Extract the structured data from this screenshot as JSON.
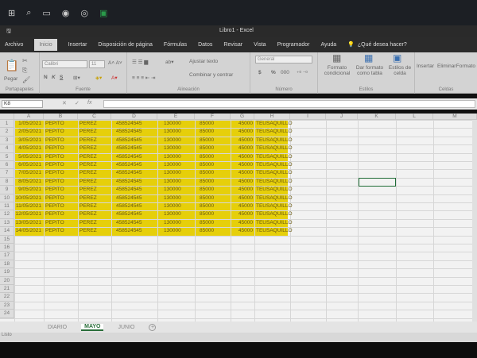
{
  "window": {
    "title": "Libro1 - Excel"
  },
  "tabs": [
    "Archivo",
    "Inicio",
    "Insertar",
    "Disposición de página",
    "Fórmulas",
    "Datos",
    "Revisar",
    "Vista",
    "Programador",
    "Ayuda"
  ],
  "tell_me": "¿Qué desea hacer?",
  "ribbon": {
    "clipboard": {
      "paste": "Pegar",
      "label": "Portapapeles"
    },
    "font": {
      "name": "Calibri",
      "size": "11",
      "bold": "N",
      "italic": "K",
      "underline": "S",
      "label": "Fuente"
    },
    "alignment": {
      "wrap": "Ajustar texto",
      "merge": "Combinar y centrar",
      "label": "Alineación"
    },
    "number": {
      "format": "General",
      "currency": "$",
      "percent": "%",
      "thousands": "000",
      "label": "Número"
    },
    "styles": {
      "conditional": "Formato condicional",
      "table": "Dar formato como tabla",
      "cell": "Estilos de celda",
      "label": "Estilos"
    },
    "cells": {
      "insert": "Insertar",
      "delete": "Eliminar",
      "format": "Formato",
      "label": "Celdas"
    }
  },
  "formula_bar": {
    "name_box": "K8",
    "cancel": "✕",
    "enter": "✓",
    "fx": "fx",
    "value": ""
  },
  "columns": [
    "A",
    "B",
    "C",
    "D",
    "E",
    "F",
    "G",
    "H",
    "I",
    "J",
    "K",
    "L",
    "M"
  ],
  "rows": [
    [
      "1/05/2021",
      "PEPITO",
      "PEREZ",
      "458524545",
      "130000",
      "85000",
      "45000",
      "TEUSAQUILLO"
    ],
    [
      "2/05/2021",
      "PEPITO",
      "PEREZ",
      "458524545",
      "130000",
      "85000",
      "45000",
      "TEUSAQUILLO"
    ],
    [
      "3/05/2021",
      "PEPITO",
      "PEREZ",
      "458524545",
      "130000",
      "85000",
      "45000",
      "TEUSAQUILLO"
    ],
    [
      "4/05/2021",
      "PEPITO",
      "PEREZ",
      "458524545",
      "130000",
      "85000",
      "45000",
      "TEUSAQUILLO"
    ],
    [
      "5/05/2021",
      "PEPITO",
      "PEREZ",
      "458524545",
      "130000",
      "85000",
      "45000",
      "TEUSAQUILLO"
    ],
    [
      "6/05/2021",
      "PEPITO",
      "PEREZ",
      "458524545",
      "130000",
      "85000",
      "45000",
      "TEUSAQUILLO"
    ],
    [
      "7/05/2021",
      "PEPITO",
      "PEREZ",
      "458524545",
      "130000",
      "85000",
      "45000",
      "TEUSAQUILLO"
    ],
    [
      "8/05/2021",
      "PEPITO",
      "PEREZ",
      "458524545",
      "130000",
      "85000",
      "45000",
      "TEUSAQUILLO"
    ],
    [
      "9/05/2021",
      "PEPITO",
      "PEREZ",
      "458524545",
      "130000",
      "85000",
      "45000",
      "TEUSAQUILLO"
    ],
    [
      "10/05/2021",
      "PEPITO",
      "PEREZ",
      "458524545",
      "130000",
      "85000",
      "45000",
      "TEUSAQUILLO"
    ],
    [
      "11/05/2021",
      "PEPITO",
      "PEREZ",
      "458524545",
      "130000",
      "85000",
      "45000",
      "TEUSAQUILLO"
    ],
    [
      "12/05/2021",
      "PEPITO",
      "PEREZ",
      "458524545",
      "130000",
      "85000",
      "45000",
      "TEUSAQUILLO"
    ],
    [
      "13/05/2021",
      "PEPITO",
      "PEREZ",
      "458524545",
      "130000",
      "85000",
      "45000",
      "TEUSAQUILLO"
    ],
    [
      "14/05/2021",
      "PEPITO",
      "PEREZ",
      "458524545",
      "130000",
      "85000",
      "45000",
      "TEUSAQUILLO"
    ]
  ],
  "total_rows": 24,
  "selected_cell": "K8",
  "highlight_color": "#e6cf0a",
  "sheets": [
    {
      "name": "DIARIO",
      "active": false
    },
    {
      "name": "MAYO",
      "active": true
    },
    {
      "name": "JUNIO",
      "active": false
    }
  ],
  "add_sheet": "+",
  "status": "Listo"
}
